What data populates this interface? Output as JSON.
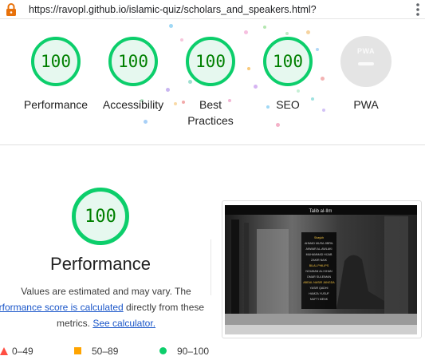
{
  "browser": {
    "url": "https://ravopl.github.io/islamic-quiz/scholars_and_speakers.html?"
  },
  "categories": [
    {
      "score": "100",
      "label": "Performance"
    },
    {
      "score": "100",
      "label": "Accessibility"
    },
    {
      "score": "100",
      "label_line1": "Best",
      "label_line2": "Practices"
    },
    {
      "score": "100",
      "label": "SEO"
    },
    {
      "badge": "PWA",
      "label": "PWA"
    }
  ],
  "performance": {
    "score": "100",
    "title": "Performance",
    "note_line1": "Values are estimated and may vary. The",
    "note_link1": "erformance score is calculated",
    "note_mid": " directly from these",
    "note_prefix2": "metrics. ",
    "note_link2": "See calculator."
  },
  "legend": [
    {
      "range": "0–49",
      "color": "#ff4e42"
    },
    {
      "range": "50–89",
      "color": "#ffa400"
    },
    {
      "range": "90–100",
      "color": "#0cce6b"
    }
  ],
  "screenshot": {
    "title": "Talib al-Ilm",
    "menu_items": [
      "Shaykh",
      "AHMAD MUSA JIBRIL",
      "ANWAR AL-AWLAKI",
      "MUHAMMAD HIJAB",
      "ZAKIR NAIK",
      "BILAL PHILIPS",
      "NOUMAN ALI KHAN",
      "OMAR SULEIMAN",
      "ABDUL NASIR JANGDA",
      "YASIR QADHI",
      "HAMZA YUSUF",
      "MUFTI MENK"
    ]
  },
  "colors": {
    "pass": "#0cce6b",
    "pass_bg": "#e6f8ef",
    "pass_text": "#008000",
    "pwa_gray": "#e4e4e4",
    "link": "#1a56c9"
  }
}
